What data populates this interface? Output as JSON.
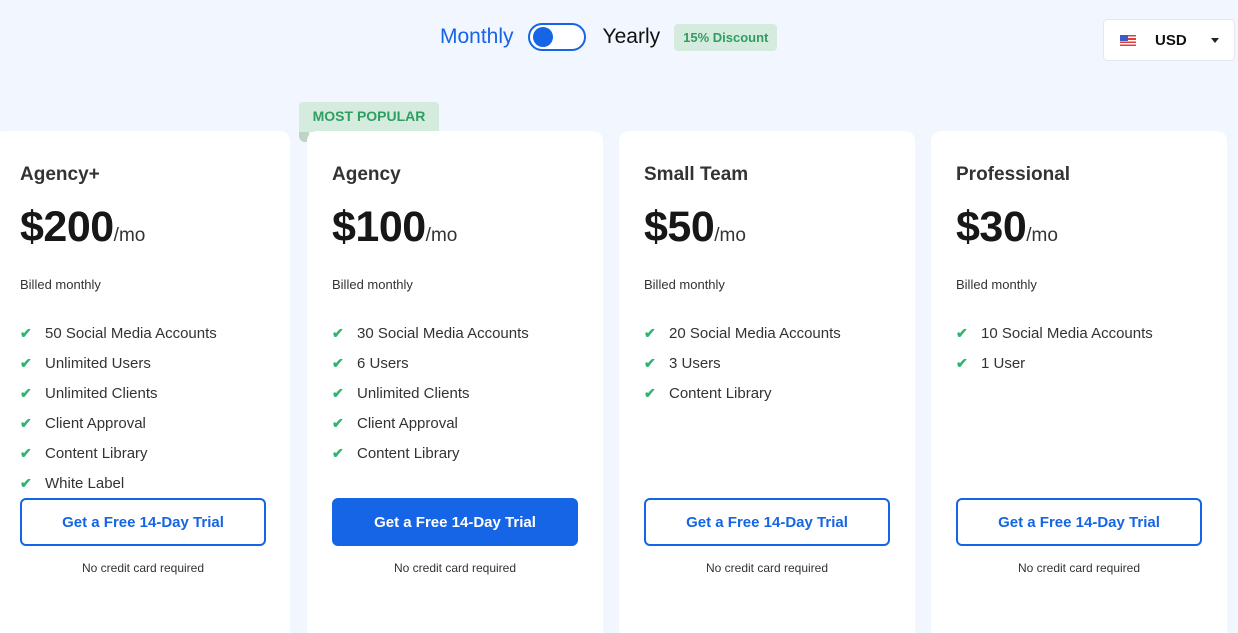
{
  "billing": {
    "monthly_label": "Monthly",
    "yearly_label": "Yearly",
    "selected": "Monthly",
    "discount_badge": "15% Discount"
  },
  "currency": {
    "flag_icon": "us-flag-icon",
    "selected": "USD"
  },
  "colors": {
    "accent": "#1565e6",
    "badge_bg": "#d5ebde",
    "badge_text": "#2f9e63",
    "check": "#2fb36f",
    "page_bg": "#f2f6fe"
  },
  "popular_badge": "MOST POPULAR",
  "plans": [
    {
      "name": "Agency+",
      "price": "$200",
      "period": "/mo",
      "billed": "Billed monthly",
      "features": [
        "50 Social Media Accounts",
        "Unlimited Users",
        "Unlimited Clients",
        "Client Approval",
        "Content Library",
        "White Label"
      ],
      "cta": "Get a Free 14-Day Trial",
      "note": "No credit card required"
    },
    {
      "name": "Agency",
      "price": "$100",
      "period": "/mo",
      "billed": "Billed monthly",
      "features": [
        "30 Social Media Accounts",
        "6 Users",
        "Unlimited Clients",
        "Client Approval",
        "Content Library"
      ],
      "cta": "Get a Free 14-Day Trial",
      "note": "No credit card required"
    },
    {
      "name": "Small Team",
      "price": "$50",
      "period": "/mo",
      "billed": "Billed monthly",
      "features": [
        "20 Social Media Accounts",
        "3 Users",
        "Content Library"
      ],
      "cta": "Get a Free 14-Day Trial",
      "note": "No credit card required"
    },
    {
      "name": "Professional",
      "price": "$30",
      "period": "/mo",
      "billed": "Billed monthly",
      "features": [
        "10 Social Media Accounts",
        "1 User"
      ],
      "cta": "Get a Free 14-Day Trial",
      "note": "No credit card required"
    }
  ]
}
